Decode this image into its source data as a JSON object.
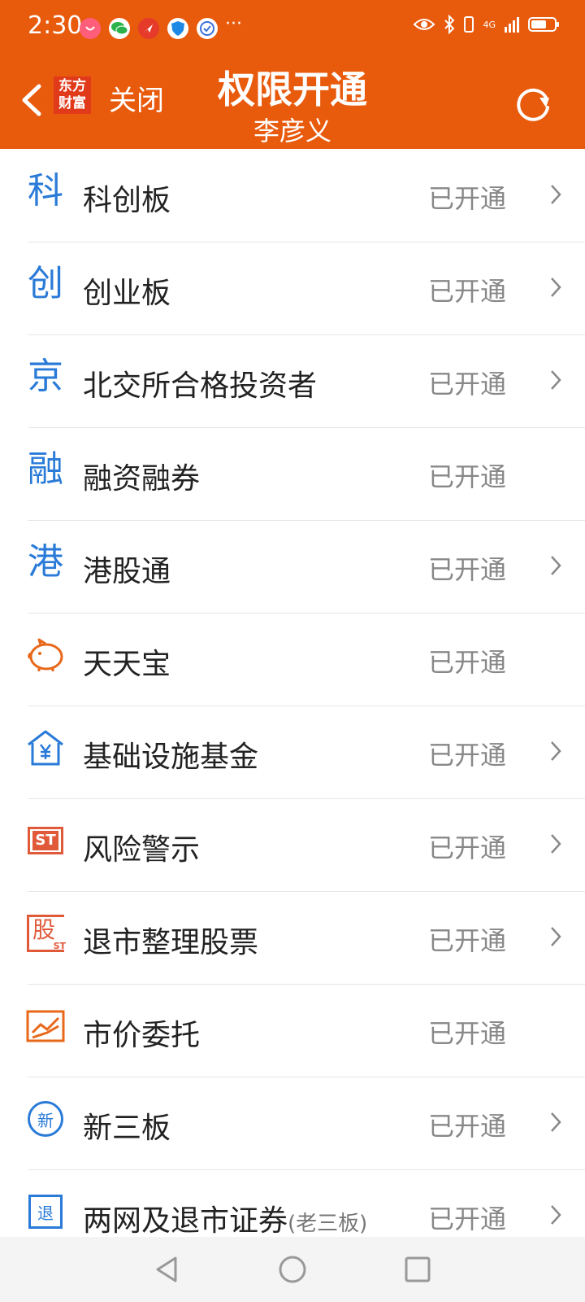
{
  "status_bar": {
    "time": "2:30",
    "more": "···",
    "network": "4G"
  },
  "header": {
    "close_label": "关闭",
    "title": "权限开通",
    "subtitle": "李彦义",
    "logo_line1": "东方",
    "logo_line2": "财富"
  },
  "items": [
    {
      "icon_char": "科",
      "label": "科创板",
      "sub": "",
      "status": "已开通",
      "arrow": true
    },
    {
      "icon_char": "创",
      "label": "创业板",
      "sub": "",
      "status": "已开通",
      "arrow": true
    },
    {
      "icon_char": "京",
      "label": "北交所合格投资者",
      "sub": "",
      "status": "已开通",
      "arrow": true
    },
    {
      "icon_char": "融",
      "label": "融资融券",
      "sub": "",
      "status": "已开通",
      "arrow": false
    },
    {
      "icon_char": "港",
      "label": "港股通",
      "sub": "",
      "status": "已开通",
      "arrow": true
    },
    {
      "icon_name": "piggy-bank-icon",
      "label": "天天宝",
      "sub": "",
      "status": "已开通",
      "arrow": false
    },
    {
      "icon_name": "house-yen-icon",
      "label": "基础设施基金",
      "sub": "",
      "status": "已开通",
      "arrow": true
    },
    {
      "icon_name": "st-badge-icon",
      "icon_text": "ST",
      "label": "风险警示",
      "sub": "",
      "status": "已开通",
      "arrow": true
    },
    {
      "icon_name": "delisting-stock-icon",
      "icon_text": "股",
      "icon_sub": "ST",
      "label": "退市整理股票",
      "sub": "",
      "status": "已开通",
      "arrow": true
    },
    {
      "icon_name": "market-order-icon",
      "label": "市价委托",
      "sub": "",
      "status": "已开通",
      "arrow": false
    },
    {
      "icon_name": "new-third-board-icon",
      "icon_text": "新",
      "label": "新三板",
      "sub": "",
      "status": "已开通",
      "arrow": true
    },
    {
      "icon_name": "old-third-board-icon",
      "icon_text": "退",
      "label": "两网及退市证券",
      "sub": "(老三板)",
      "status": "已开通",
      "arrow": true
    }
  ],
  "colors": {
    "header_bg": "#e85a0c",
    "accent_blue": "#2a7bd8",
    "accent_orange": "#e8681a",
    "accent_red": "#e05a3a"
  }
}
